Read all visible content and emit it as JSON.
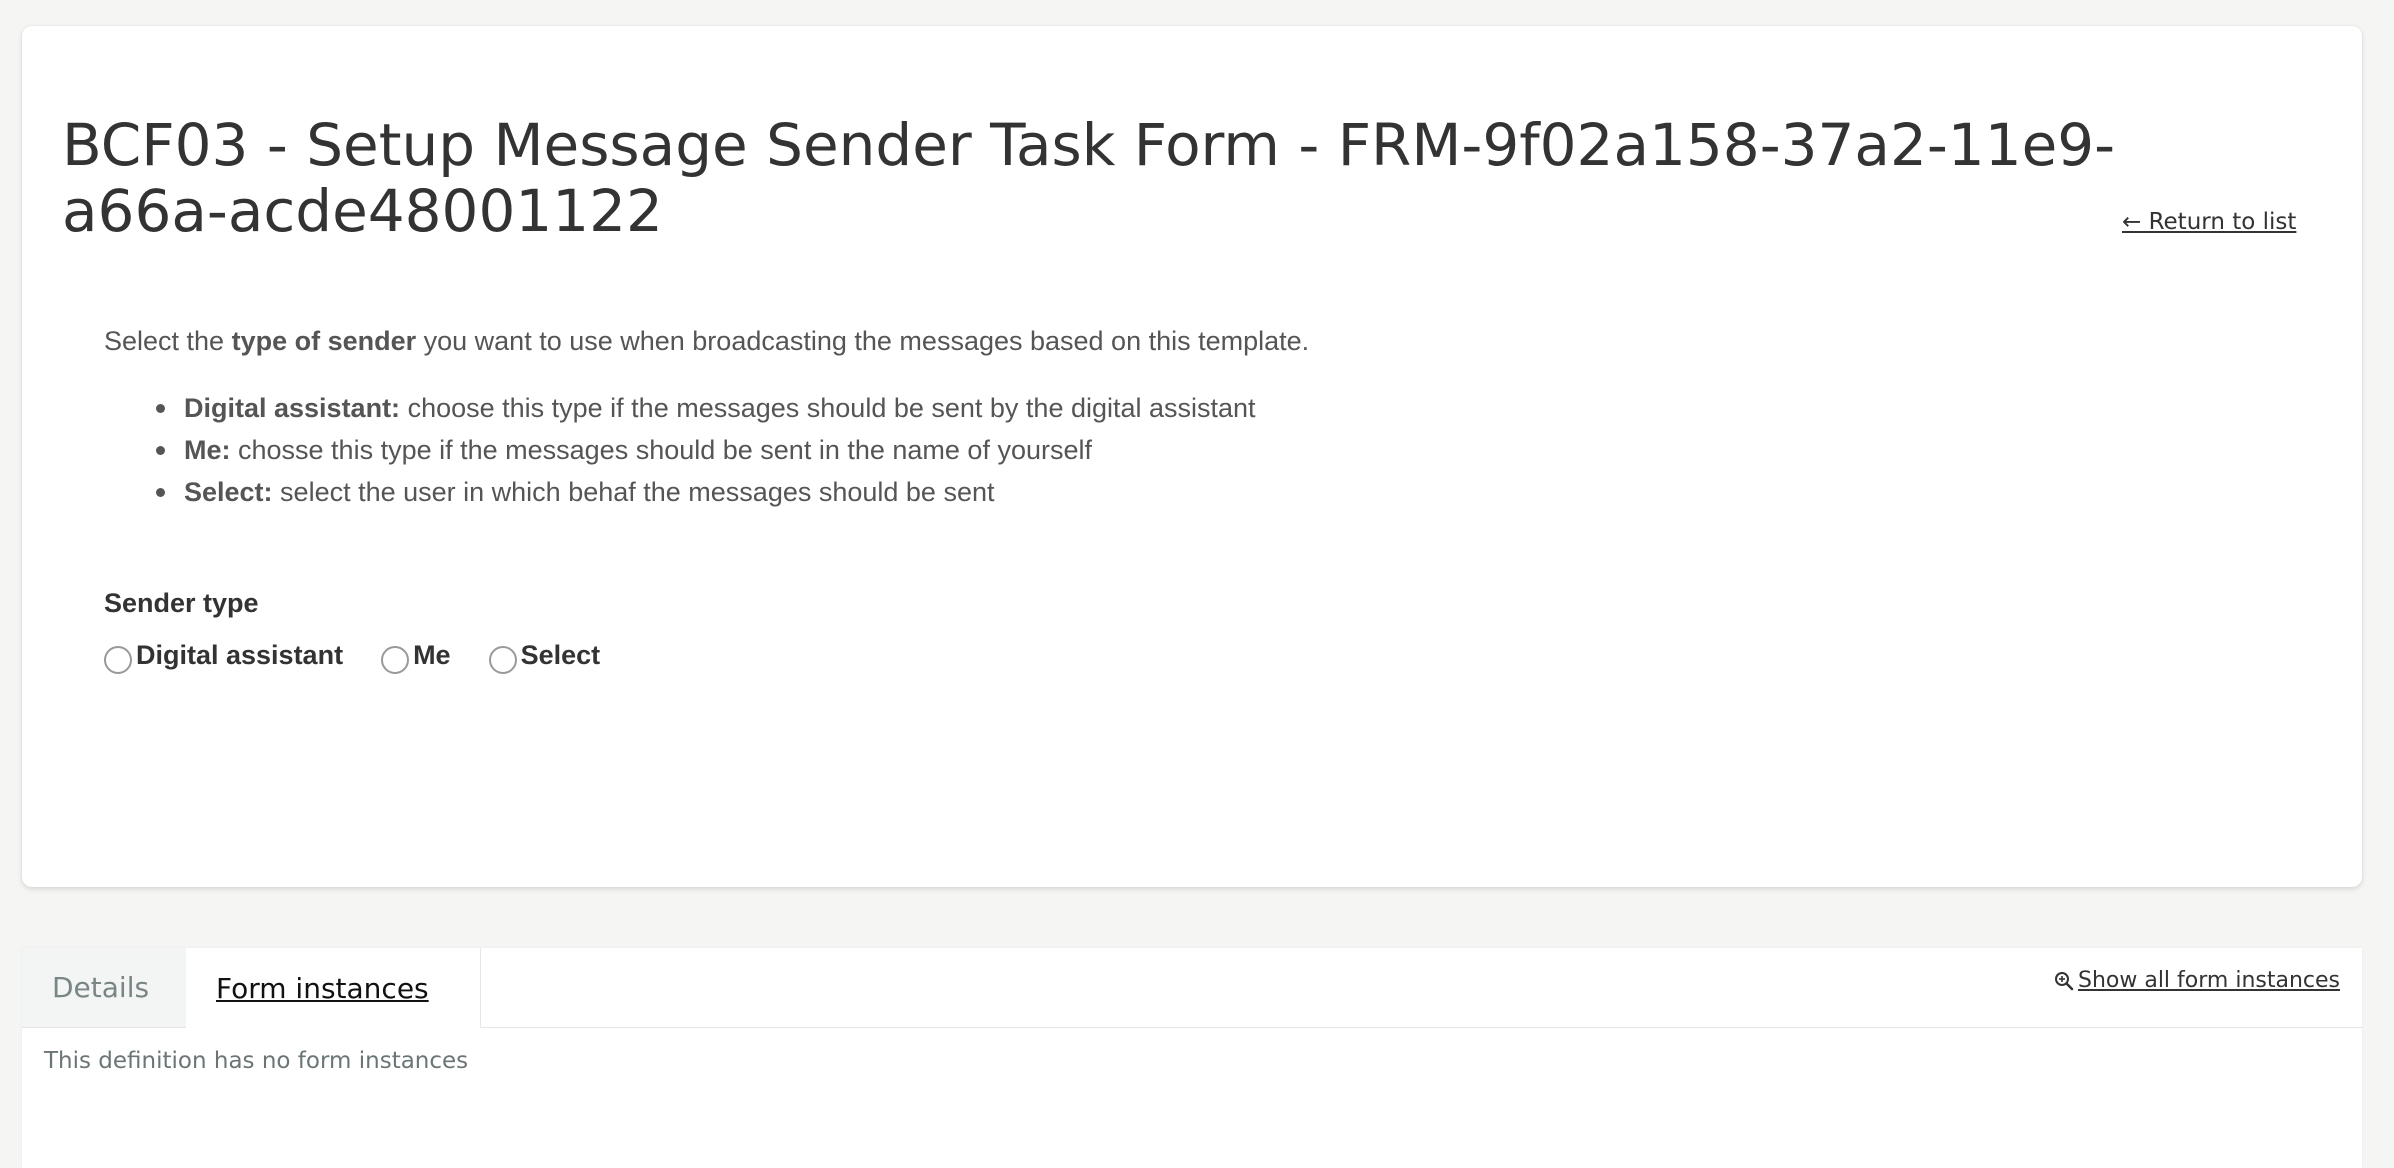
{
  "form": {
    "title": "BCF03 - Setup Message Sender Task Form - FRM-9f02a158-37a2-11e9-a66a-acde48001122",
    "return_link": "← Return to list",
    "intro": {
      "prefix": "Select the ",
      "bold": "type of sender",
      "suffix": " you want to use when broadcasting the messages based on this template."
    },
    "bullets": [
      {
        "term": "Digital assistant:",
        "text": " choose this type if the messages should be sent by the digital assistant"
      },
      {
        "term": "Me:",
        "text": " chosse this type if the messages should be sent in the name of yourself"
      },
      {
        "term": "Select:",
        "text": " select the user in which behaf the messages should be sent"
      }
    ],
    "sender_type": {
      "label": "Sender type",
      "options": [
        "Digital assistant",
        "Me",
        "Select"
      ],
      "selected": null
    }
  },
  "panel": {
    "tabs": [
      {
        "label": "Details",
        "active": false
      },
      {
        "label": "Form instances ",
        "active": true
      }
    ],
    "show_all_link": "Show all form instances",
    "empty_message": "This definition has no form instances"
  },
  "icons": {
    "show_all": "zoom-in-icon",
    "return": "arrow-left-icon"
  }
}
